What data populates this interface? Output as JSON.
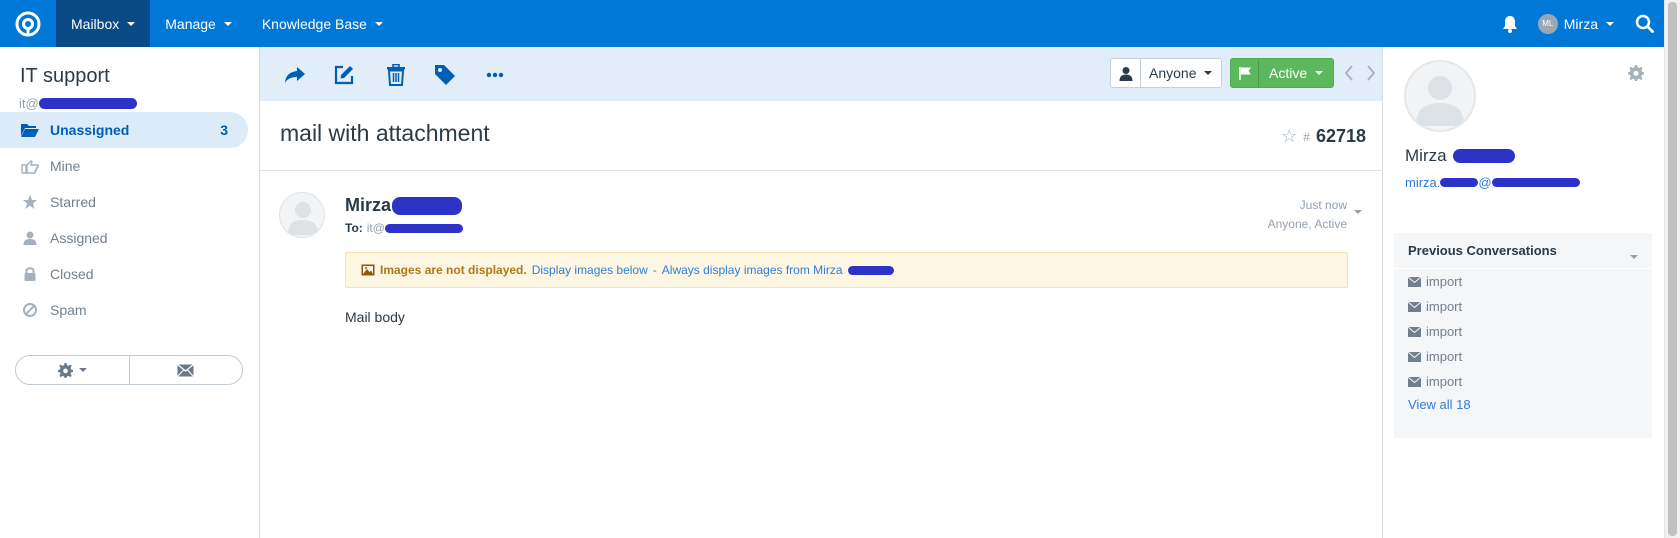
{
  "topnav": {
    "items": [
      {
        "label": "Mailbox",
        "active": true
      },
      {
        "label": "Manage",
        "active": false
      },
      {
        "label": "Knowledge Base",
        "active": false
      }
    ],
    "user": {
      "initials": "ML",
      "name": "Mirza"
    },
    "colors": {
      "bar": "#0078d7",
      "active": "#0a4a86"
    }
  },
  "sidebar": {
    "mailbox_name": "IT support",
    "mailbox_email_prefix": "it@",
    "folders": [
      {
        "label": "Unassigned",
        "count": "3",
        "icon": "folder-open-icon",
        "active": true
      },
      {
        "label": "Mine",
        "count": "",
        "icon": "hand-point-icon"
      },
      {
        "label": "Starred",
        "count": "",
        "icon": "star-icon"
      },
      {
        "label": "Assigned",
        "count": "",
        "icon": "user-icon"
      },
      {
        "label": "Closed",
        "count": "",
        "icon": "lock-icon"
      },
      {
        "label": "Spam",
        "count": "",
        "icon": "ban-icon"
      }
    ]
  },
  "toolbar": {
    "assignee": "Anyone",
    "status": "Active",
    "status_color": "#5cb85c"
  },
  "conversation": {
    "subject": "mail with attachment",
    "hash": "#",
    "number": "62718"
  },
  "thread": {
    "sender": "Mirza",
    "to_label": "To:",
    "to_prefix": "it@",
    "time": "Just now",
    "meta": "Anyone, Active",
    "notice_warning": "Images are not displayed.",
    "notice_display": "Display images below",
    "notice_sep": "-",
    "notice_always": "Always display images from Mirza",
    "body": "Mail body"
  },
  "customer": {
    "name": "Mirza",
    "email_prefix": "mirza.",
    "email_at": "@",
    "prev_title": "Previous Conversations",
    "prev_items": [
      "import",
      "import",
      "import",
      "import",
      "import"
    ],
    "view_all": "View all 18"
  }
}
